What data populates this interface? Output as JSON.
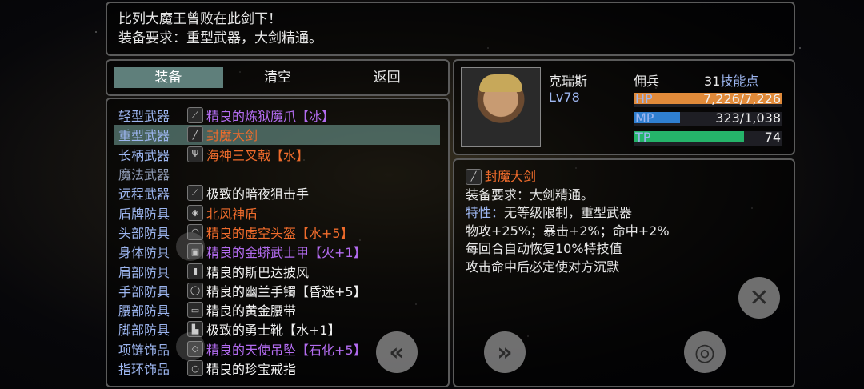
{
  "description": {
    "line1": "比列大魔王曾败在此剑下！",
    "line2": "装备要求：重型武器，大剑精通。"
  },
  "tabs": [
    {
      "label": "装备",
      "active": true
    },
    {
      "label": "清空",
      "active": false
    },
    {
      "label": "返回",
      "active": false
    }
  ],
  "equipment": [
    {
      "slot": "轻型武器",
      "icon": "claw-icon",
      "item": "精良的炼狱魔爪【冰】",
      "color": "#b36cf0"
    },
    {
      "slot": "重型武器",
      "icon": "sword-icon",
      "item": "封魔大剑",
      "color": "#f06c2c",
      "selected": true
    },
    {
      "slot": "长柄武器",
      "icon": "trident-icon",
      "item": "海神三叉戟【水】",
      "color": "#f06c2c"
    },
    {
      "slot": "魔法武器",
      "icon": "",
      "item": "",
      "color": "#f0f0f0"
    },
    {
      "slot": "远程武器",
      "icon": "rifle-icon",
      "item": "极致的暗夜狙击手",
      "color": "#f0f0f0"
    },
    {
      "slot": "盾牌防具",
      "icon": "shield-icon",
      "item": "北风神盾",
      "color": "#f06c2c"
    },
    {
      "slot": "头部防具",
      "icon": "helmet-icon",
      "item": "精良的虚空头盔【水+5】",
      "color": "#f06c2c"
    },
    {
      "slot": "身体防具",
      "icon": "armor-icon",
      "item": "精良的金蟒武士甲【火+1】",
      "color": "#b36cf0"
    },
    {
      "slot": "肩部防具",
      "icon": "cloak-icon",
      "item": "精良的斯巴达披风",
      "color": "#f0f0f0"
    },
    {
      "slot": "手部防具",
      "icon": "bracelet-icon",
      "item": "精良的幽兰手镯【昏迷+5】",
      "color": "#f0f0f0"
    },
    {
      "slot": "腰部防具",
      "icon": "belt-icon",
      "item": "精良的黄金腰带",
      "color": "#f0f0f0"
    },
    {
      "slot": "脚部防具",
      "icon": "boots-icon",
      "item": "极致的勇士靴【水+1】",
      "color": "#f0f0f0"
    },
    {
      "slot": "项链饰品",
      "icon": "pendant-icon",
      "item": "精良的天使吊坠【石化+5】",
      "color": "#b36cf0"
    },
    {
      "slot": "指环饰品",
      "icon": "ring-icon",
      "item": "精良的珍宝戒指",
      "color": "#f0f0f0"
    }
  ],
  "character": {
    "name": "克瑞斯",
    "level": "Lv78",
    "class": "佣兵",
    "skill_points_num": "31",
    "skill_points_label": "技能点",
    "hp": {
      "label": "HP",
      "value": "7,226/7,226",
      "fraction": 1.0,
      "color": "#e08a3a"
    },
    "mp": {
      "label": "MP",
      "value": "323/1,038",
      "fraction": 0.31,
      "color": "#2f7fd0"
    },
    "tp": {
      "label": "TP",
      "value": "74",
      "fraction": 0.74,
      "color": "#25b46a"
    }
  },
  "item_info": {
    "name": "封魔大剑",
    "icon": "sword-icon",
    "req": "装备要求：大剑精通。",
    "trait_label": "特性：",
    "trait": "无等级限制，重型武器",
    "stats": "物攻+25%；暴击+2%；命中+2%",
    "effect1": "每回合自动恢复10%特技值",
    "effect2": "攻击命中后必定使对方沉默"
  },
  "buttons": {
    "prev_icon": "«",
    "next_icon": "»",
    "confirm_icon": "◎",
    "close_icon": "✕"
  }
}
